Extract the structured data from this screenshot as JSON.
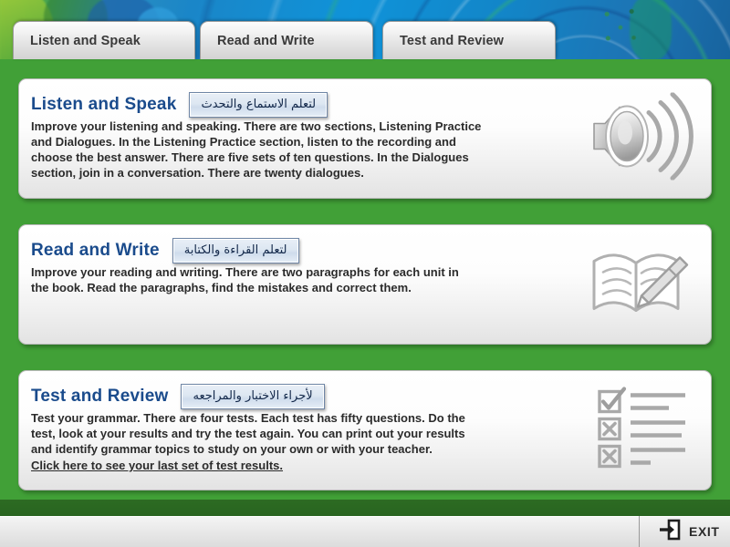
{
  "app": {
    "bg_green": "#41a037",
    "heading_color": "#1a4b8c",
    "banner_blue": "#0f93d9"
  },
  "tabs": [
    {
      "id": "tab0",
      "label": "Listen and Speak",
      "icon": "tab-icon",
      "selected": true
    },
    {
      "id": "tab1",
      "label": "Read and Write",
      "icon": "tab-icon",
      "selected": false
    },
    {
      "id": "tab2",
      "label": "Test and Review",
      "icon": "tab-icon",
      "selected": false
    }
  ],
  "panels": [
    {
      "title": "Listen and Speak",
      "tooltip": "لتعلم الاستماع والتحدث",
      "lines": [
        "Improve your listening and speaking. There are two sections, Listening Practice",
        "and Dialogues. In the Listening Practice section, listen to the recording and",
        "choose the best answer. There are five sets of ten questions. In the Dialogues",
        "section, join in a conversation. There are twenty dialogues."
      ],
      "icon": "speaker-icon",
      "link": ""
    },
    {
      "title": "Read and Write",
      "tooltip": "لتعلم القراءة والكتابة",
      "lines": [
        "Improve your reading and writing. There are two paragraphs for each unit in",
        "the book. Read the paragraphs, find the mistakes and correct them."
      ],
      "icon": "book-pencil-icon",
      "link": ""
    },
    {
      "title": "Test and Review",
      "tooltip": "لأجراء الاختبار والمراجعه",
      "lines": [
        "Test your grammar. There are four tests. Each test has fifty questions. Do the",
        "test, look at your results and try the test again. You can print out your results",
        "and identify grammar topics to study on your own or with your teacher."
      ],
      "icon": "checklist-icon",
      "link": "Click here to see your last set of test results."
    }
  ],
  "bottom": {
    "exit_label": "EXIT",
    "exit_icon": "exit-arrow-icon"
  }
}
